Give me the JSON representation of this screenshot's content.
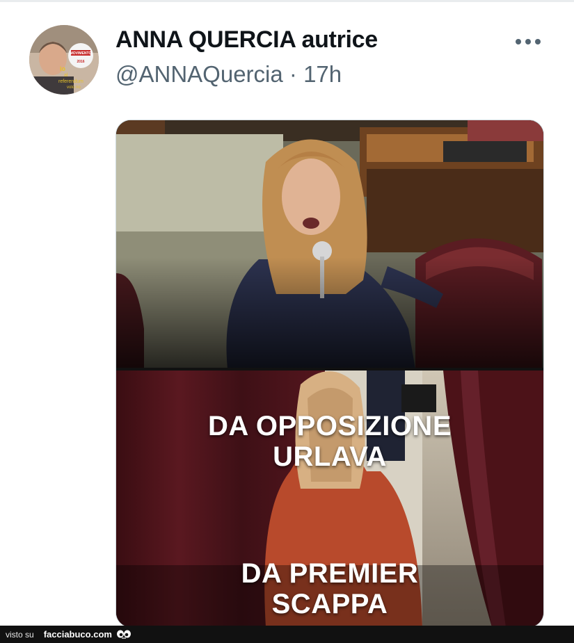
{
  "tweet": {
    "display_name": "ANNA QUERCIA autrice",
    "handle": "@ANNAQuercia",
    "separator": "·",
    "time": "17h",
    "more_icon": "more-horizontal-icon"
  },
  "avatar": {
    "badge_text": "MOVIMENTO",
    "badge_year": "2016",
    "overlay_line1": "io",
    "overlay_line2": "al",
    "overlay_line3": "referendum",
    "overlay_line4": "voto no"
  },
  "media": {
    "caption_top_line1": "DA OPPOSIZIONE",
    "caption_top_line2": "URLAVA",
    "caption_bottom_line1": "DA PREMIER",
    "caption_bottom_line2": "SCAPPA"
  },
  "footer": {
    "visto_label": "visto su",
    "brand": "facciabuco.com"
  },
  "colors": {
    "name_text": "#0f1419",
    "secondary_text": "#536471",
    "card_border": "#cfd9de",
    "footer_bg": "#111111"
  }
}
